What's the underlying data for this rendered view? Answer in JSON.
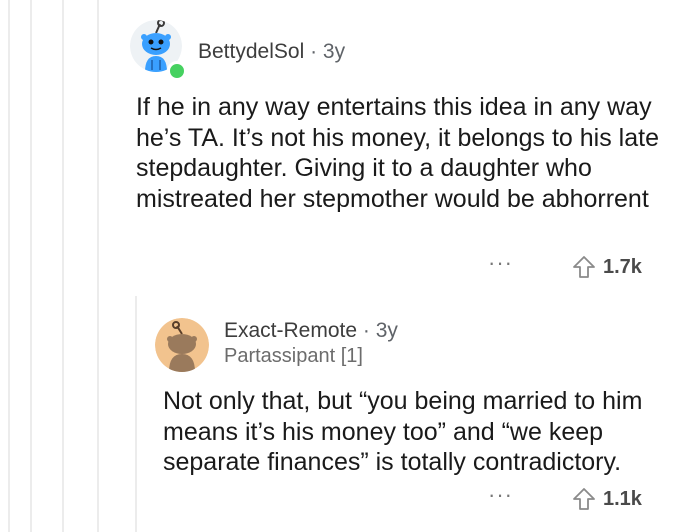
{
  "comments": [
    {
      "username": "BettydelSol",
      "separator": "·",
      "age": "3y",
      "body": "If he in any way entertains this idea in any way he’s TA. It’s not his money, it belongs to his late stepdaughter. Giving it to a daughter who mistreated her stepmother would be abhorrent",
      "more": "···",
      "votes": "1.7k",
      "avatar_icon": "snoo-avatar-blue",
      "online": true
    },
    {
      "username": "Exact-Remote",
      "separator": "·",
      "age": "3y",
      "flair": "Partassipant [1]",
      "body": "Not only that, but “you being married to him means it’s his money too” and “we keep separate finances” is totally contradictory.",
      "more": "···",
      "votes": "1.1k",
      "avatar_icon": "snoo-avatar-brown"
    }
  ],
  "colors": {
    "accent_blue": "#3aa0ff",
    "online_green": "#46d160",
    "avatar_bg_brown": "#f2c38e"
  }
}
